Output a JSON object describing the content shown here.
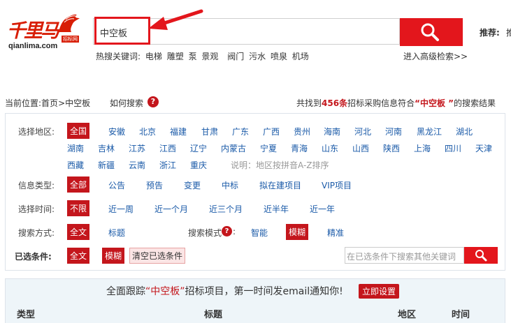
{
  "header": {
    "logo_text": "千里马",
    "logo_tag": "招标网",
    "logo_domain": "qianlima.com",
    "search_value": "中空板",
    "hot_label": "热搜关键词:",
    "hot_keywords": [
      "电梯",
      "雕塑",
      "泵",
      "景观",
      "阀门",
      "污水",
      "喷泉",
      "机场"
    ],
    "advanced_search": "进入高级检索>>",
    "recommend_label": "推荐:",
    "recommend_more": "推"
  },
  "breadcrumb": {
    "prefix": "当前位置:",
    "home": "首页",
    "sep": ">",
    "current": "中空板",
    "help": "如何搜索",
    "help_icon": "?"
  },
  "result": {
    "pre": "共找到",
    "count": "456条",
    "mid": "招标采购信息符合",
    "keyword": "“中空板 ”",
    "post": "的搜索结果"
  },
  "filters": {
    "region_label": "选择地区:",
    "regions_row1": [
      "全国",
      "安徽",
      "北京",
      "福建",
      "甘肃",
      "广东",
      "广西",
      "贵州",
      "海南",
      "河北",
      "河南",
      "黑龙江",
      "湖北"
    ],
    "regions_row2": [
      "湖南",
      "吉林",
      "江苏",
      "江西",
      "辽宁",
      "内蒙古",
      "宁夏",
      "青海",
      "山东",
      "山西",
      "陕西",
      "上海",
      "四川",
      "天津"
    ],
    "regions_row3": [
      "西藏",
      "新疆",
      "云南",
      "浙江",
      "重庆"
    ],
    "region_note": "说明：地区按拼音A-Z排序",
    "type_label": "信息类型:",
    "types": [
      "全部",
      "公告",
      "预告",
      "变更",
      "中标",
      "拟在建项目",
      "VIP项目"
    ],
    "time_label": "选择时间:",
    "times": [
      "不限",
      "近一周",
      "近一个月",
      "近三个月",
      "近半年",
      "近一年"
    ],
    "method_label": "搜索方式:",
    "methods": [
      "全文",
      "标题"
    ],
    "mode_label": "搜索模式",
    "mode_help": "?",
    "mode_colon": ":",
    "modes": [
      "智能",
      "模糊",
      "精准"
    ],
    "chosen_label": "已选条件:",
    "chosen": [
      "全文",
      "模糊"
    ],
    "clear": "清空已选条件",
    "cond_placeholder": "在已选条件下搜索其他关键词"
  },
  "track": {
    "pre": "全面跟踪",
    "keyword": "“中空板”",
    "post": "招标项目，第一时间发email通知你!",
    "button": "立即设置"
  },
  "table": {
    "headers": [
      "类型",
      "标题",
      "地区",
      "时间"
    ]
  },
  "colors": {
    "brand_red": "#e3161c",
    "selected_red": "#c4161c",
    "link_blue": "#1a5aa8"
  }
}
